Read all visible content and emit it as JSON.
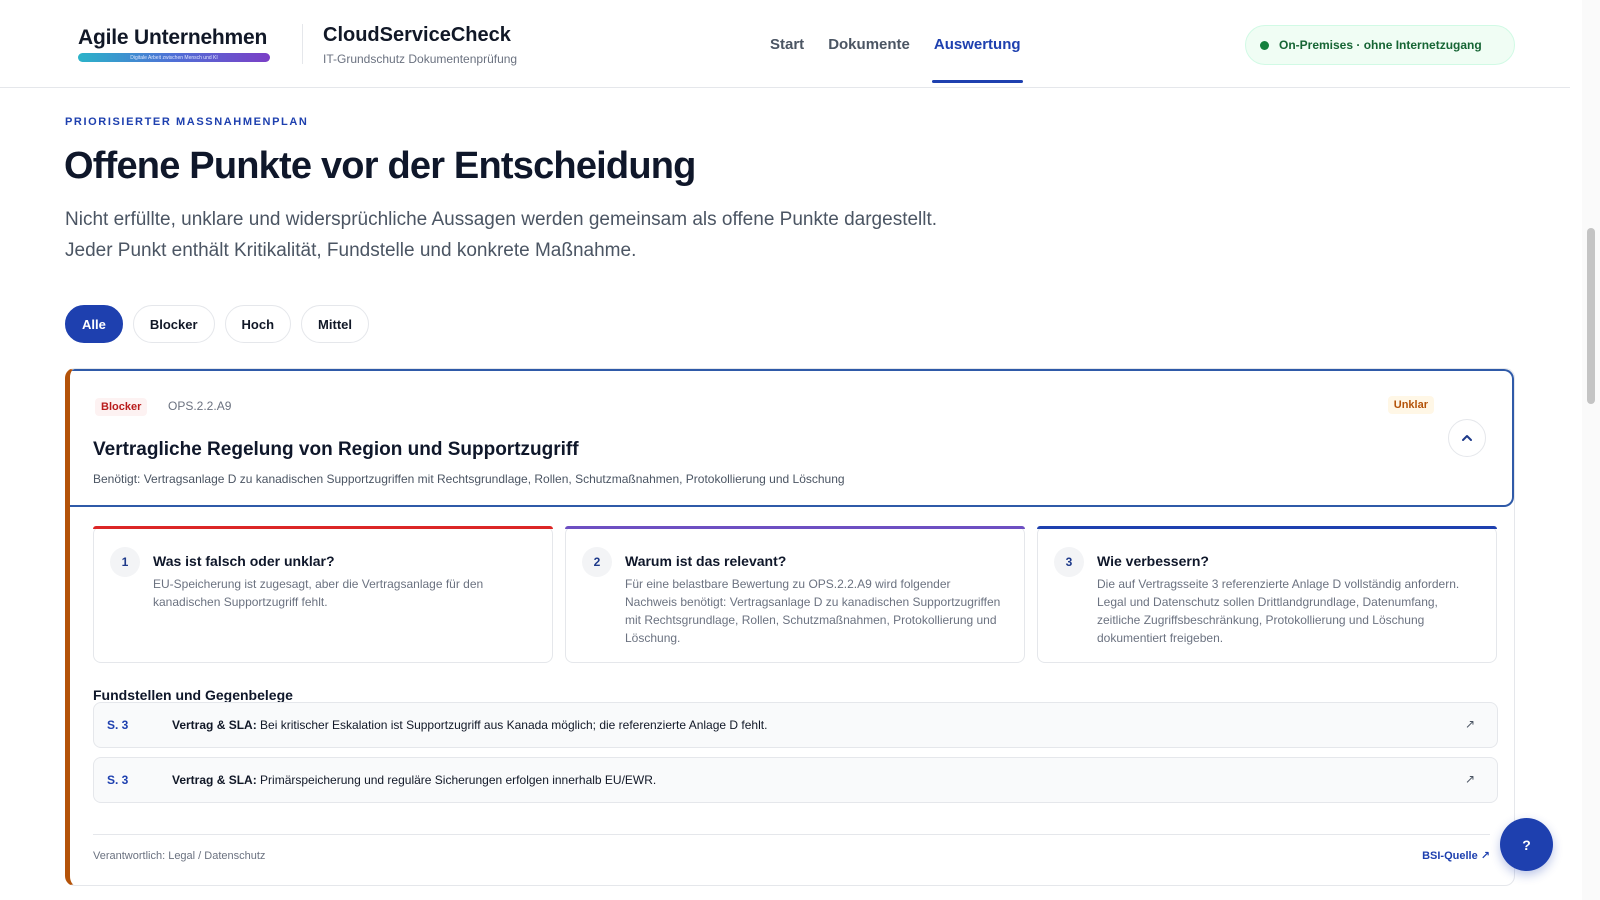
{
  "header": {
    "logo_text": "Agile Unternehmen",
    "logo_tagline": "Digitale Arbeit zwischen Mensch und KI",
    "product_name": "CloudServiceCheck",
    "product_sub": "IT-Grundschutz Dokumentenprüfung",
    "nav": [
      {
        "label": "Start",
        "active": false
      },
      {
        "label": "Dokumente",
        "active": false
      },
      {
        "label": "Auswertung",
        "active": true
      }
    ],
    "status": "On-Premises · ohne Internetzugang"
  },
  "hero": {
    "eyebrow": "PRIORISIERTER MASSNAHMENPLAN",
    "title": "Offene Punkte vor der Entscheidung",
    "intro": "Nicht erfüllte, unklare und widersprüchliche Aussagen werden gemeinsam als offene Punkte dargestellt. Jeder Punkt enthält Kritikalität, Fundstelle und konkrete Maßnahme."
  },
  "filters": [
    "Alle",
    "Blocker",
    "Hoch",
    "Mittel"
  ],
  "issue": {
    "severity": "Blocker",
    "code": "OPS.2.2.A9",
    "status": "Unklar",
    "title": "Vertragliche Regelung von Region und Supportzugriff",
    "need": "Benötigt: Vertragsanlage D zu kanadischen Supportzugriffen mit Rechtsgrundlage, Rollen, Schutzmaßnahmen, Protokollierung und Löschung",
    "steps": [
      {
        "num": "1",
        "title": "Was ist falsch oder unklar?",
        "body": "EU-Speicherung ist zugesagt, aber die Vertragsanlage für den kanadischen Supportzugriff fehlt.",
        "accent": "#dc2626"
      },
      {
        "num": "2",
        "title": "Warum ist das relevant?",
        "body": "Für eine belastbare Bewertung zu OPS.2.2.A9 wird folgender Nachweis benötigt: Vertragsanlage D zu kanadischen Supportzugriffen mit Rechtsgrundlage, Rollen, Schutzmaßnahmen, Protokollierung und Löschung.",
        "accent": "#6d4fc2"
      },
      {
        "num": "3",
        "title": "Wie verbessern?",
        "body": "Die auf Vertragsseite 3 referenzierte Anlage D vollständig anfordern. Legal und Datenschutz sollen Drittlandgrundlage, Datenumfang, zeitliche Zugriffsbeschränkung, Protokollierung und Löschung dokumentiert freigeben.",
        "accent": "#1e40af"
      }
    ],
    "refs_title": "Fundstellen und Gegenbelege",
    "refs": [
      {
        "page": "S. 3",
        "source": "Vertrag & SLA:",
        "text": "Bei kritischer Eskalation ist Supportzugriff aus Kanada möglich; die referenzierte Anlage D fehlt."
      },
      {
        "page": "S. 3",
        "source": "Vertrag & SLA:",
        "text": "Primärspeicherung und reguläre Sicherungen erfolgen innerhalb EU/EWR."
      }
    ],
    "owner": "Verantwortlich: Legal / Datenschutz",
    "bsi_link": "BSI-Quelle ↗"
  },
  "help_label": "?",
  "colors": {
    "brand": "#1e40af",
    "blocker": "#b91c1c",
    "unklar": "#b45309",
    "status_green": "#15803d"
  }
}
